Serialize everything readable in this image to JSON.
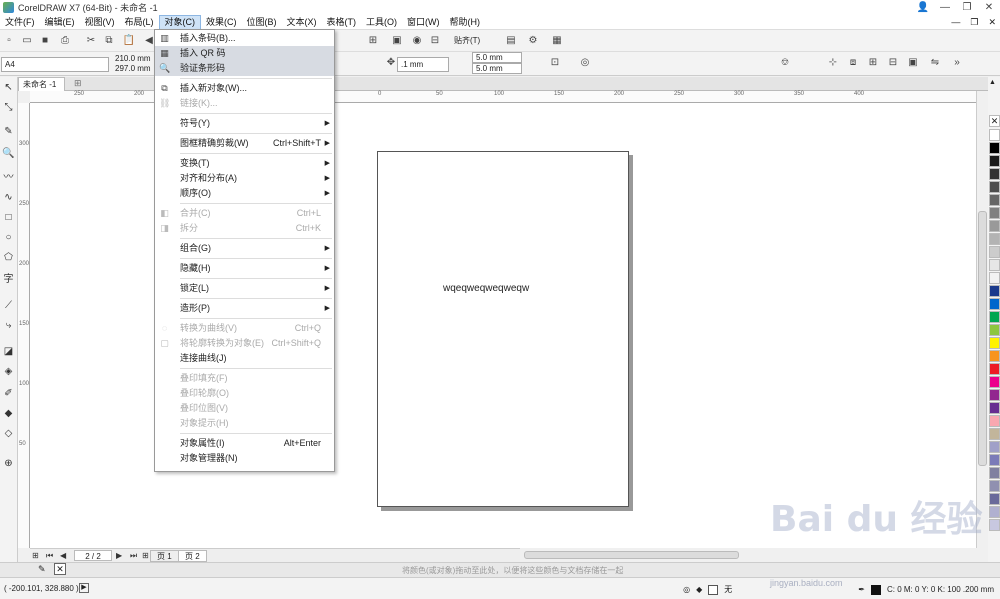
{
  "window": {
    "title": "CorelDRAW X7 (64-Bit) - 未命名 -1"
  },
  "menu": [
    "文件(F)",
    "编辑(E)",
    "视图(V)",
    "布局(L)",
    "对象(C)",
    "效果(C)",
    "位图(B)",
    "文本(X)",
    "表格(T)",
    "工具(O)",
    "窗口(W)",
    "帮助(H)"
  ],
  "toolbar": {
    "paper_size": "A4",
    "width": "210.0 mm",
    "height": "297.0 mm",
    "nudge": ".1 mm",
    "dup_x": "5.0 mm",
    "dup_y": "5.0 mm",
    "snap": "贴齐(T)"
  },
  "doc_tab": "未命名 -1",
  "ruler": {
    "h_labels": [
      "250",
      "200",
      "150",
      "100",
      "50",
      "0",
      "50",
      "100",
      "150",
      "200",
      "250",
      "300",
      "350",
      "400"
    ],
    "v_labels": [
      "300",
      "250",
      "200",
      "150",
      "100",
      "50"
    ]
  },
  "page": {
    "text": "wqeqweqweqweqw"
  },
  "object_menu": [
    {
      "label": "插入条码(B)...",
      "icon": "barcode-icon",
      "enabled": true
    },
    {
      "label": "插入 QR 码",
      "icon": "qr-code-icon",
      "enabled": true,
      "highlight": true
    },
    {
      "label": "验证条形码",
      "icon": "magnifier-icon",
      "enabled": true,
      "highlight": true
    },
    {
      "sep": true
    },
    {
      "label": "插入新对象(W)...",
      "icon": "new-object-icon",
      "enabled": true
    },
    {
      "label": "链接(K)...",
      "icon": "link-icon",
      "enabled": false
    },
    {
      "sep": true
    },
    {
      "label": "符号(Y)",
      "submenu": true,
      "enabled": true
    },
    {
      "sep": true
    },
    {
      "label": "图框精确剪裁(W)",
      "shortcut": "Ctrl+Shift+T",
      "submenu": true,
      "enabled": true
    },
    {
      "sep": true
    },
    {
      "label": "变换(T)",
      "submenu": true,
      "enabled": true
    },
    {
      "label": "对齐和分布(A)",
      "submenu": true,
      "enabled": true
    },
    {
      "label": "顺序(O)",
      "submenu": true,
      "enabled": true
    },
    {
      "sep": true
    },
    {
      "label": "合并(C)",
      "icon": "combine-icon",
      "shortcut": "Ctrl+L",
      "enabled": false
    },
    {
      "label": "拆分",
      "icon": "break-apart-icon",
      "shortcut": "Ctrl+K",
      "enabled": false
    },
    {
      "sep": true
    },
    {
      "label": "组合(G)",
      "submenu": true,
      "enabled": true
    },
    {
      "sep": true
    },
    {
      "label": "隐藏(H)",
      "submenu": true,
      "enabled": true
    },
    {
      "sep": true
    },
    {
      "label": "锁定(L)",
      "submenu": true,
      "enabled": true
    },
    {
      "sep": true
    },
    {
      "label": "造形(P)",
      "submenu": true,
      "enabled": true
    },
    {
      "sep": true
    },
    {
      "label": "转换为曲线(V)",
      "icon": "convert-curves-icon",
      "shortcut": "Ctrl+Q",
      "enabled": false
    },
    {
      "label": "将轮廓转换为对象(E)",
      "icon": "outline-object-icon",
      "shortcut": "Ctrl+Shift+Q",
      "enabled": false
    },
    {
      "label": "连接曲线(J)",
      "enabled": true
    },
    {
      "sep": true
    },
    {
      "label": "叠印填充(F)",
      "enabled": false
    },
    {
      "label": "叠印轮廓(O)",
      "enabled": false
    },
    {
      "label": "叠印位图(V)",
      "enabled": false
    },
    {
      "label": "对象提示(H)",
      "enabled": false
    },
    {
      "sep": true
    },
    {
      "label": "对象属性(I)",
      "shortcut": "Alt+Enter",
      "enabled": true
    },
    {
      "label": "对象管理器(N)",
      "enabled": true
    }
  ],
  "page_nav": {
    "count": "2 / 2",
    "tabs": [
      "页 1",
      "页 2"
    ]
  },
  "doc_palette_hint": "将颜色(或对象)拖动至此处，以便将这些颜色与文档存储在一起",
  "status": {
    "coords": "( -200.101, 328.880 )",
    "fill": "无",
    "outline": "C: 0 M: 0 Y: 0 K: 100  .200 mm"
  },
  "palette_colors": [
    "#ffffff",
    "#000000",
    "#1a1a1a",
    "#333333",
    "#4d4d4d",
    "#666666",
    "#808080",
    "#999999",
    "#b3b3b3",
    "#cccccc",
    "#e6e6e6",
    "#f2f2f2",
    "#1b3a8c",
    "#0066cc",
    "#00a651",
    "#8dc63f",
    "#fff200",
    "#f7941d",
    "#ed1c24",
    "#ec008c",
    "#92278f",
    "#662d91",
    "#f9a7b0",
    "#c2b59b",
    "#a0a0c8",
    "#7b7bb8",
    "#8080a0",
    "#9090b0",
    "#6a6a9a",
    "#b0b0d0",
    "#c8c8e0"
  ],
  "watermark": {
    "main": "Bai du 经验",
    "sub": "jingyan.baidu.com"
  }
}
